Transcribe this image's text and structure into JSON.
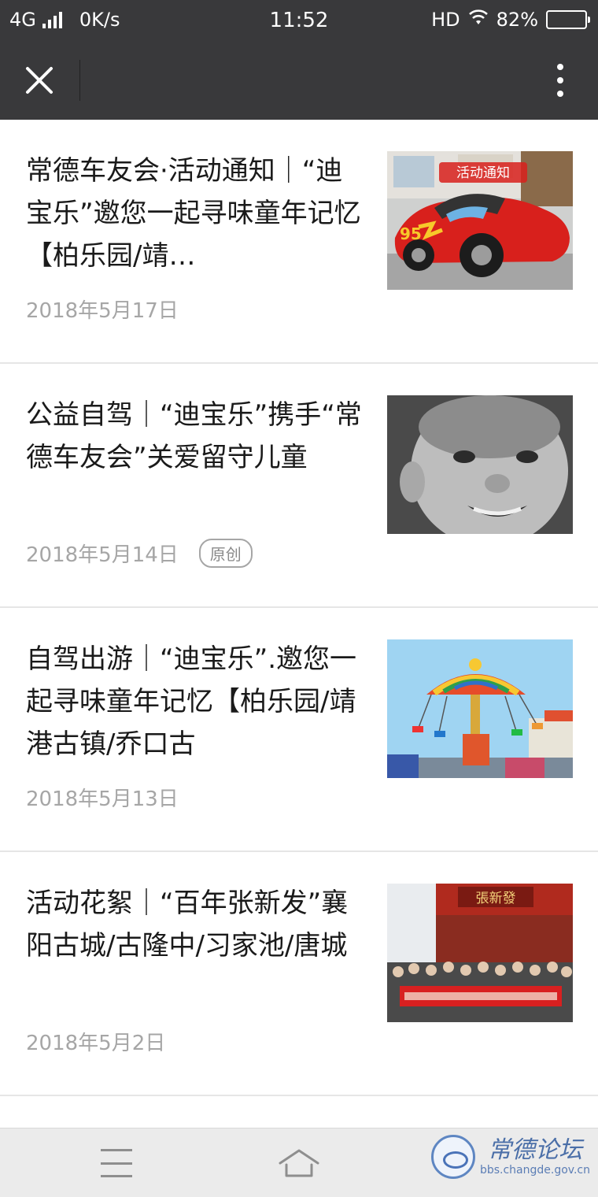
{
  "status_bar": {
    "network": "4G",
    "speed": "0K/s",
    "time": "11:52",
    "hd": "HD",
    "battery": "82%",
    "battery_level": 0.82
  },
  "toolbar": {
    "close_icon": "close-icon",
    "more_icon": "more-vertical-icon"
  },
  "articles": [
    {
      "title": "常德车友会·活动通知｜“迪宝乐”邀您一起寻味童年记忆【柏乐园/靖…",
      "date": "2018年5月17日",
      "thumb": "red-race-car-image",
      "thumb_caption": "活动通知"
    },
    {
      "title": "公益自驾｜“迪宝乐”携手“常德车友会”关爱留守儿童",
      "date": "2018年5月14日",
      "badge": "原创",
      "thumb": "smiling-child-photo"
    },
    {
      "title": "自驾出游｜“迪宝乐”.邀您一起寻味童年记忆【柏乐园/靖港古镇/乔口古",
      "date": "2018年5月13日",
      "thumb": "carousel-swing-ride-photo"
    },
    {
      "title": "活动花絮｜“百年张新发”襄阳古城/古隆中/习家池/唐城",
      "date": "2018年5月2日",
      "thumb": "group-photo-banner",
      "thumb_caption": "張新發"
    }
  ],
  "bottom_bar": {
    "menu_icon": "menu-icon",
    "home_icon": "home-icon"
  },
  "watermark": {
    "title": "常德论坛",
    "url": "bbs.changde.gov.cn"
  }
}
